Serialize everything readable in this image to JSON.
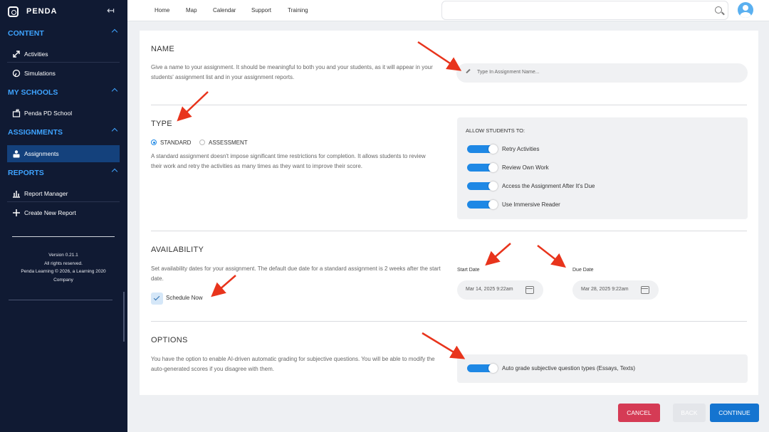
{
  "sidebar": {
    "brand": "PENDA",
    "sections": [
      {
        "title": "CONTENT",
        "items": [
          {
            "label": "Activities"
          },
          {
            "label": "Simulations"
          }
        ]
      },
      {
        "title": "MY SCHOOLS",
        "items": [
          {
            "label": "Penda PD School"
          }
        ]
      },
      {
        "title": "ASSIGNMENTS",
        "items": [
          {
            "label": "Assignments"
          }
        ]
      },
      {
        "title": "REPORTS",
        "items": [
          {
            "label": "Report Manager"
          },
          {
            "label": "Create New Report"
          }
        ]
      }
    ],
    "footer": {
      "version": "Version 0.21.1",
      "rights": "All rights reserved.",
      "company": "Penda Learning © 2026, a Learning 2020 Company"
    }
  },
  "topbar": {
    "nav": [
      "Home",
      "Map",
      "Calendar",
      "Support",
      "Training"
    ],
    "search_value": ""
  },
  "name_section": {
    "heading": "NAME",
    "description": "Give a name to your assignment. It should be meaningful to both you and your students, as it will appear in your students' assignment list and in your assignment reports.",
    "placeholder": "Type In Assignment Name..."
  },
  "type_section": {
    "heading": "TYPE",
    "options": [
      "STANDARD",
      "ASSESSMENT"
    ],
    "selected": "STANDARD",
    "description": "A standard assignment doesn't impose significant time restrictions for completion. It allows students to review their work and retry the activities as many times as they want to improve their score.",
    "allow_title": "ALLOW STUDENTS TO:",
    "toggles": [
      {
        "label": "Retry Activities",
        "on": true
      },
      {
        "label": "Review Own Work",
        "on": true
      },
      {
        "label": "Access the Assignment After It's Due",
        "on": true
      },
      {
        "label": "Use Immersive Reader",
        "on": true
      }
    ]
  },
  "availability": {
    "heading": "AVAILABILITY",
    "description": "Set availability dates for your assignment. The default due date for a standard assignment is 2 weeks after the start date.",
    "schedule_label": "Schedule Now",
    "start_label": "Start Date",
    "start_value": "Mar 14, 2025 9:22am",
    "due_label": "Due Date",
    "due_value": "Mar 28, 2025 9:22am"
  },
  "options": {
    "heading": "OPTIONS",
    "description": "You have the option to enable AI-driven automatic grading for subjective questions. You will be able to modify the auto-generated scores if you disagree with them.",
    "auto_grade_label": "Auto grade subjective question types (Essays, Texts)",
    "auto_grade_on": true
  },
  "footer_buttons": {
    "cancel": "CANCEL",
    "back": "BACK",
    "continue": "CONTINUE"
  },
  "colors": {
    "sidebar_bg": "#101a33",
    "accent": "#1e88e5",
    "cancel": "#d53b55",
    "annotation_arrow": "#e8341c"
  }
}
